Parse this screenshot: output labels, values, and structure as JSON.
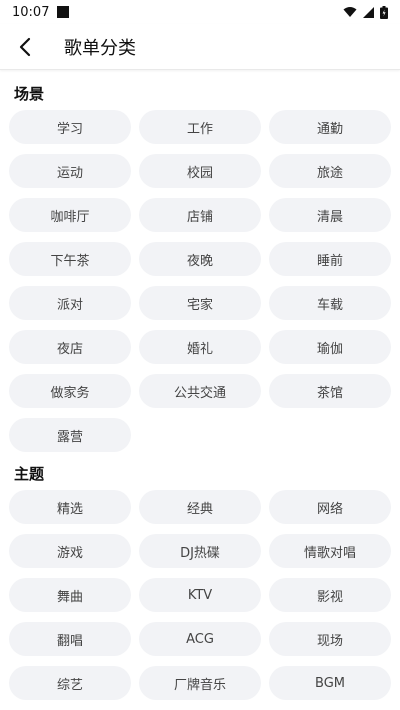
{
  "status_bar": {
    "time": "10:07"
  },
  "header": {
    "title": "歌单分类"
  },
  "sections": [
    {
      "title": "场景",
      "items": [
        "学习",
        "工作",
        "通勤",
        "运动",
        "校园",
        "旅途",
        "咖啡厅",
        "店铺",
        "清晨",
        "下午茶",
        "夜晚",
        "睡前",
        "派对",
        "宅家",
        "车载",
        "夜店",
        "婚礼",
        "瑜伽",
        "做家务",
        "公共交通",
        "茶馆",
        "露营"
      ]
    },
    {
      "title": "主题",
      "items": [
        "精选",
        "经典",
        "网络",
        "游戏",
        "DJ热碟",
        "情歌对唱",
        "舞曲",
        "KTV",
        "影视",
        "翻唱",
        "ACG",
        "现场",
        "综艺",
        "厂牌音乐",
        "BGM"
      ]
    }
  ]
}
